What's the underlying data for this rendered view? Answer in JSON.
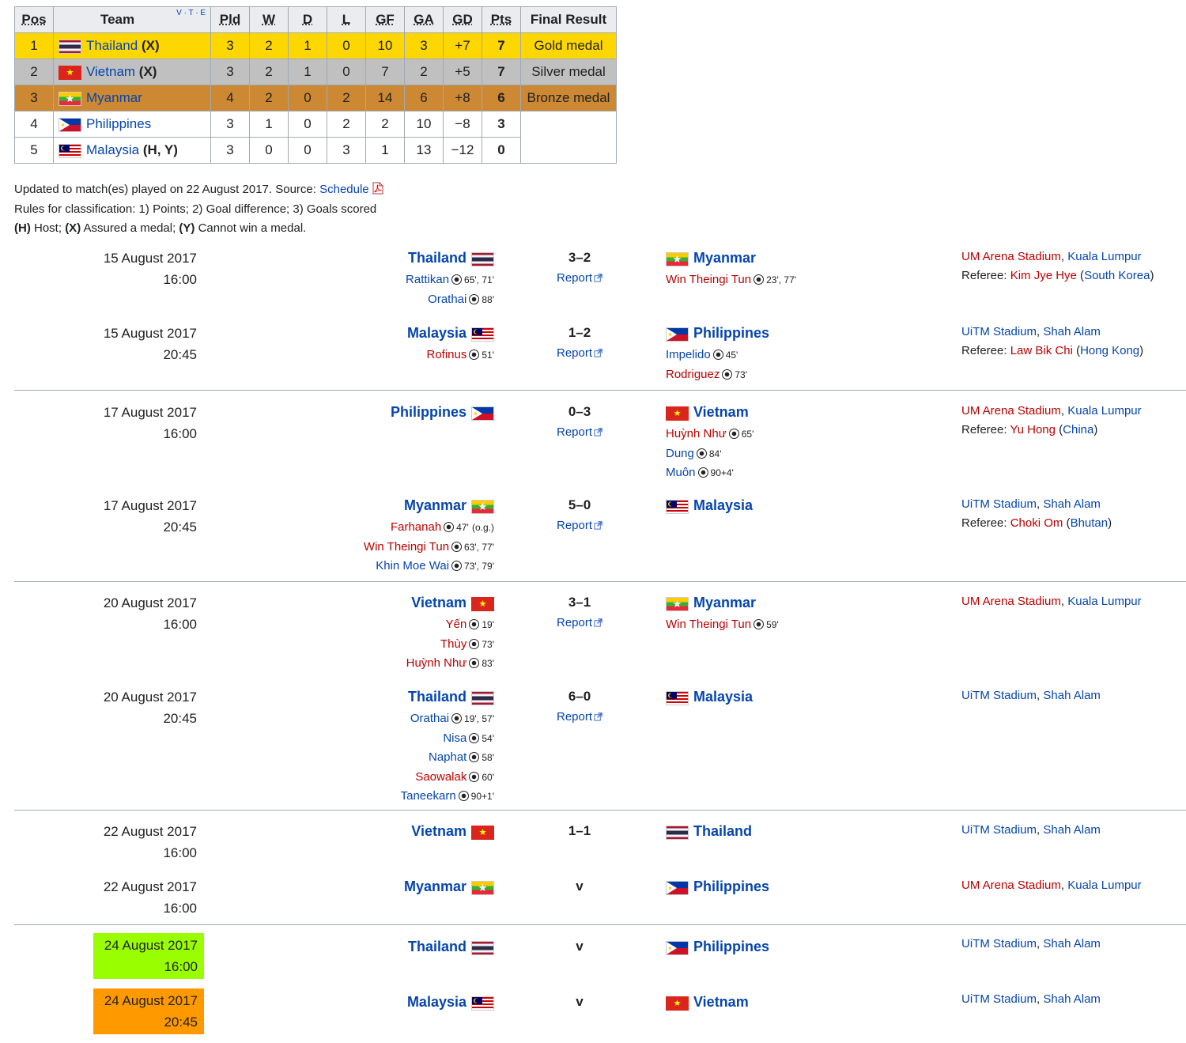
{
  "standings": {
    "headers": {
      "pos": "Pos",
      "team": "Team",
      "vte": "V · T · E",
      "pld": "Pld",
      "w": "W",
      "d": "D",
      "l": "L",
      "gf": "GF",
      "ga": "GA",
      "gd": "GD",
      "pts": "Pts",
      "result": "Final Result"
    },
    "rows": [
      {
        "pos": "1",
        "team": "Thailand",
        "suffix": "(X)",
        "pld": "3",
        "w": "2",
        "d": "1",
        "l": "0",
        "gf": "10",
        "ga": "3",
        "gd": "+7",
        "pts": "7",
        "result": "Gold medal"
      },
      {
        "pos": "2",
        "team": "Vietnam",
        "suffix": "(X)",
        "pld": "3",
        "w": "2",
        "d": "1",
        "l": "0",
        "gf": "7",
        "ga": "2",
        "gd": "+5",
        "pts": "7",
        "result": "Silver medal"
      },
      {
        "pos": "3",
        "team": "Myanmar",
        "suffix": "",
        "pld": "4",
        "w": "2",
        "d": "0",
        "l": "2",
        "gf": "14",
        "ga": "6",
        "gd": "+8",
        "pts": "6",
        "result": "Bronze medal"
      },
      {
        "pos": "4",
        "team": "Philippines",
        "suffix": "",
        "pld": "3",
        "w": "1",
        "d": "0",
        "l": "2",
        "gf": "2",
        "ga": "10",
        "gd": "−8",
        "pts": "3",
        "result": ""
      },
      {
        "pos": "5",
        "team": "Malaysia",
        "suffix": "(H, Y)",
        "pld": "3",
        "w": "0",
        "d": "0",
        "l": "3",
        "gf": "1",
        "ga": "13",
        "gd": "−12",
        "pts": "0",
        "result": ""
      }
    ]
  },
  "notes": {
    "updated_prefix": "Updated to match(es) played on 22 August 2017. Source: ",
    "source_link": "Schedule",
    "rules": "Rules for classification: 1) Points; 2) Goal difference; 3) Goals scored",
    "legend_h": "(H)",
    "legend_h_text": " Host; ",
    "legend_x": "(X)",
    "legend_x_text": " Assured a medal; ",
    "legend_y": "(Y)",
    "legend_y_text": " Cannot win a medal."
  },
  "matches": {
    "m1": {
      "date": "15 August 2017",
      "time": "16:00",
      "home": "Thailand",
      "score": "3–2",
      "report": "Report",
      "away": "Myanmar",
      "home_goals": [
        {
          "name": "Rattikan",
          "min": "65', 71'"
        },
        {
          "name": "Orathai",
          "min": "88'"
        }
      ],
      "away_goals": [
        {
          "name": "Win Theingi Tun",
          "min": "23', 77'"
        }
      ],
      "venue": "UM Arena Stadium",
      "city": "Kuala Lumpur",
      "ref_label": "Referee: ",
      "referee": "Kim Jye Hye",
      "ref_country": "South Korea"
    },
    "m2": {
      "date": "15 August 2017",
      "time": "20:45",
      "home": "Malaysia",
      "score": "1–2",
      "report": "Report",
      "away": "Philippines",
      "home_goals": [
        {
          "name": "Rofinus",
          "min": "51'"
        }
      ],
      "away_goals": [
        {
          "name": "Impelido",
          "min": "45'"
        },
        {
          "name": "Rodriguez",
          "min": "73'"
        }
      ],
      "venue": "UiTM Stadium",
      "city": "Shah Alam",
      "ref_label": "Referee: ",
      "referee": "Law Bik Chi",
      "ref_country": "Hong Kong"
    },
    "m3": {
      "date": "17 August 2017",
      "time": "16:00",
      "home": "Philippines",
      "score": "0–3",
      "report": "Report",
      "away": "Vietnam",
      "away_goals": [
        {
          "name": "Huỳnh Như",
          "min": "65'"
        },
        {
          "name": "Dung",
          "min": "84'"
        },
        {
          "name": "Muôn",
          "min": "90+4'"
        }
      ],
      "venue": "UM Arena Stadium",
      "city": "Kuala Lumpur",
      "ref_label": "Referee: ",
      "referee": "Yu Hong",
      "ref_country": "China"
    },
    "m4": {
      "date": "17 August 2017",
      "time": "20:45",
      "home": "Myanmar",
      "score": "5–0",
      "report": "Report",
      "away": "Malaysia",
      "home_goals": [
        {
          "name": "Farhanah",
          "min": "47'",
          "og": "(o.g.)"
        },
        {
          "name": "Win Theingi Tun",
          "min": "63', 77'"
        },
        {
          "name": "Khin Moe Wai",
          "min": "73', 79'"
        }
      ],
      "venue": "UiTM Stadium",
      "city": "Shah Alam",
      "ref_label": "Referee: ",
      "referee": "Choki Om",
      "ref_country": "Bhutan"
    },
    "m5": {
      "date": "20 August 2017",
      "time": "16:00",
      "home": "Vietnam",
      "score": "3–1",
      "report": "Report",
      "away": "Myanmar",
      "home_goals": [
        {
          "name": "Yến",
          "min": "19'"
        },
        {
          "name": "Thùy",
          "min": "73'"
        },
        {
          "name": "Huỳnh Như",
          "min": "83'"
        }
      ],
      "away_goals": [
        {
          "name": "Win Theingi Tun",
          "min": "59'"
        }
      ],
      "venue": "UM Arena Stadium",
      "city": "Kuala Lumpur"
    },
    "m6": {
      "date": "20 August 2017",
      "time": "20:45",
      "home": "Thailand",
      "score": "6–0",
      "report": "Report",
      "away": "Malaysia",
      "home_goals": [
        {
          "name": "Orathai",
          "min": "19', 57'"
        },
        {
          "name": "Nisa",
          "min": "54'"
        },
        {
          "name": "Naphat",
          "min": "58'"
        },
        {
          "name": "Saowalak",
          "min": "60'"
        },
        {
          "name": "Taneekarn",
          "min": "90+1'"
        }
      ],
      "venue": "UiTM Stadium",
      "city": "Shah Alam"
    },
    "m7": {
      "date": "22 August 2017",
      "time": "16:00",
      "home": "Vietnam",
      "score": "1–1",
      "away": "Thailand",
      "venue": "UiTM Stadium",
      "city": "Shah Alam"
    },
    "m8": {
      "date": "22 August 2017",
      "time": "16:00",
      "home": "Myanmar",
      "score": "v",
      "away": "Philippines",
      "venue": "UM Arena Stadium",
      "city": "Kuala Lumpur"
    },
    "m9": {
      "date": "24 August 2017",
      "time": "16:00",
      "home": "Thailand",
      "score": "v",
      "away": "Philippines",
      "venue": "UiTM Stadium",
      "city": "Shah Alam",
      "highlight": "#99ff00"
    },
    "m10": {
      "date": "24 August 2017",
      "time": "20:45",
      "home": "Malaysia",
      "score": "v",
      "away": "Vietnam",
      "venue": "UiTM Stadium",
      "city": "Shah Alam",
      "highlight": "#ff9900"
    }
  },
  "colors": {
    "gold": "#ffd700",
    "silver": "#c0c0c0",
    "bronze": "#cc8833",
    "link": "#0645ad",
    "redlink": "#ba0000"
  },
  "icons": {
    "ball": "soccer-ball-icon",
    "external": "external-link-icon",
    "pdf": "pdf-icon"
  }
}
